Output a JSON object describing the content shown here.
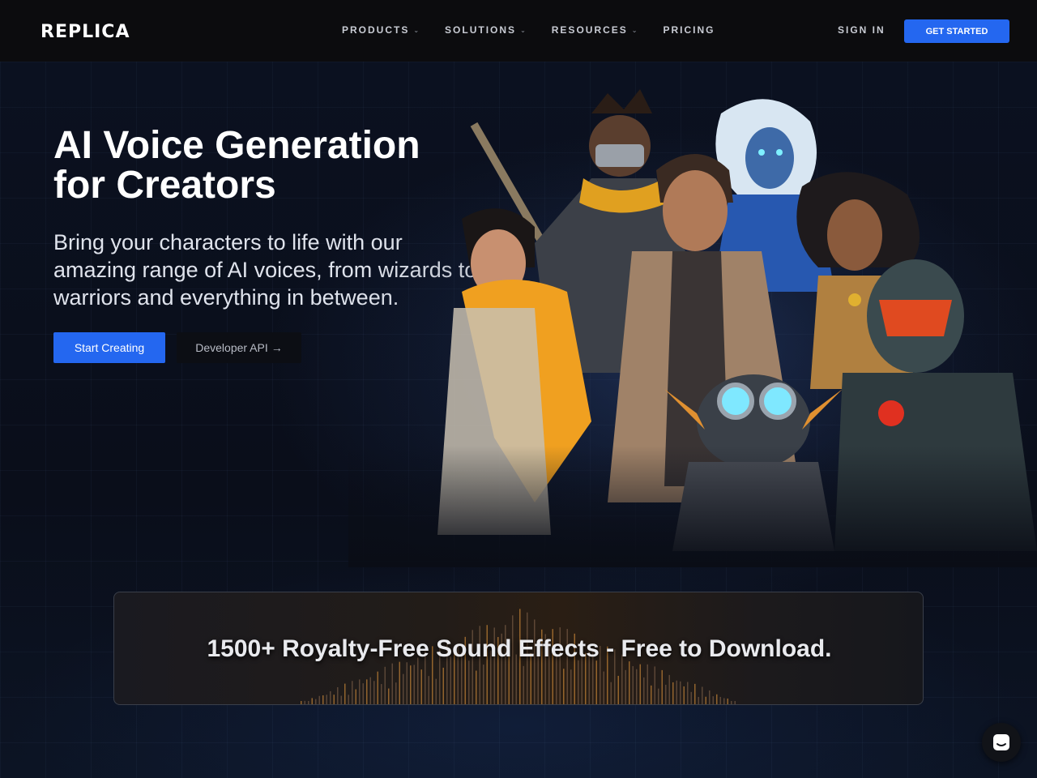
{
  "header": {
    "logo": "REPLICA",
    "nav": [
      {
        "label": "PRODUCTS",
        "has_dropdown": true
      },
      {
        "label": "SOLUTIONS",
        "has_dropdown": true
      },
      {
        "label": "RESOURCES",
        "has_dropdown": true
      },
      {
        "label": "PRICING",
        "has_dropdown": false
      }
    ],
    "sign_in": "SIGN IN",
    "cta": "GET STARTED"
  },
  "hero": {
    "title": "AI Voice Generation for Creators",
    "subtitle": "Bring your characters to life with our amazing range of AI voices, from wizards to warriors and everything in between.",
    "primary_button": "Start Creating",
    "secondary_button": "Developer API",
    "secondary_icon": "arrow-right-icon"
  },
  "banner": {
    "text": "1500+ Royalty-Free Sound Effects - Free to Download."
  },
  "chat": {
    "icon": "chat-icon"
  },
  "colors": {
    "accent": "#2467f0",
    "background": "#0a0d16",
    "header": "#0c0c0e"
  }
}
